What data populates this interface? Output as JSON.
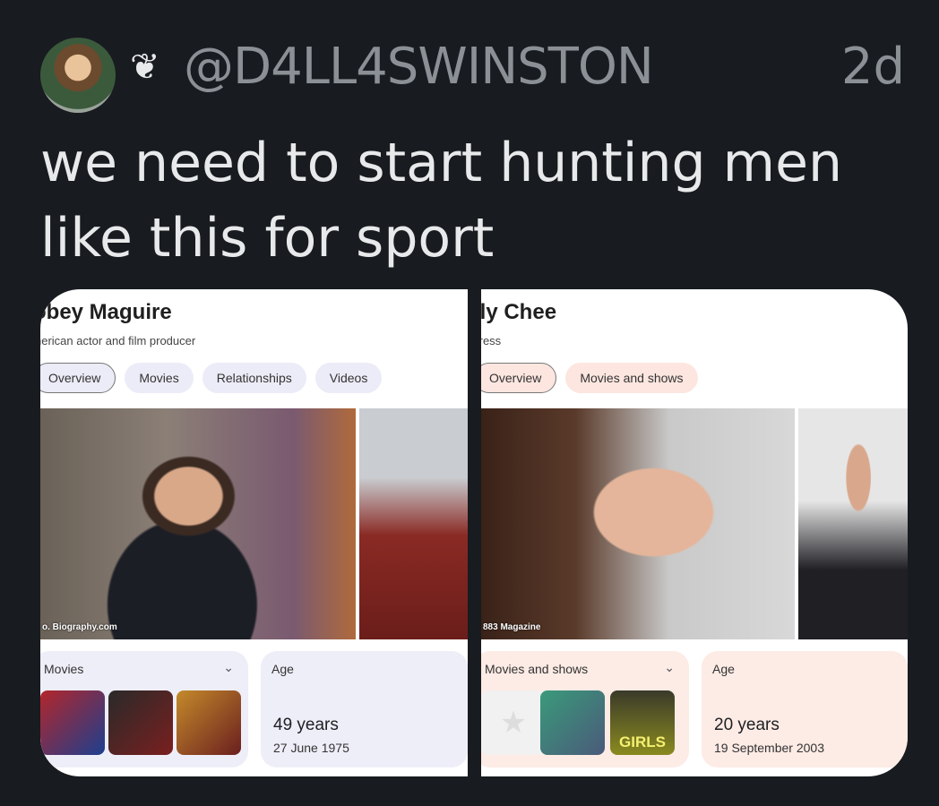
{
  "tweet": {
    "handle": "@D4LL4SWINSTON",
    "emoji": "❦",
    "time": "2d",
    "text": "we need to start hunting men like this for sport"
  },
  "left": {
    "name": "obey Maguire",
    "description": "nerican actor and film producer",
    "chips": [
      "Overview",
      "Movies",
      "Relationships",
      "Videos"
    ],
    "image_credit": "o. Biography.com",
    "movies_label": "Movies",
    "age_label": "Age",
    "age": "49 years",
    "birthdate": "27 June 1975"
  },
  "right": {
    "name": "ily Chee",
    "description": "tress",
    "chips": [
      "Overview",
      "Movies and shows"
    ],
    "image_credit": "883 Magazine",
    "movies_label": "Movies and shows",
    "age_label": "Age",
    "age": "20 years",
    "birthdate": "19 September 2003",
    "thumb_text": "GIRLS"
  }
}
